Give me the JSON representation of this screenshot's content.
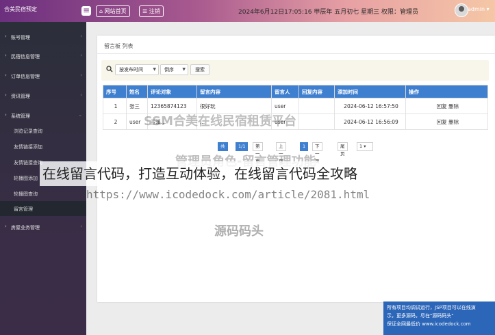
{
  "header": {
    "brand": "合美民宿预定",
    "nav_home": "网站首页",
    "nav_logout": "注销",
    "datetime": "2024年6月12日17:05:16 甲辰年 五月初七 星期三",
    "role_label": "权限：管理员",
    "user": "admin"
  },
  "sidebar": {
    "items": [
      {
        "label": "账号管理"
      },
      {
        "label": "民宿信息管理"
      },
      {
        "label": "订单信息管理"
      },
      {
        "label": "资讯管理"
      },
      {
        "label": "系统管理"
      }
    ],
    "sub_items": [
      {
        "label": "浏览记录查询"
      },
      {
        "label": "友情链接添加"
      },
      {
        "label": "友情链接查询"
      },
      {
        "label": "轮播图添加"
      },
      {
        "label": "轮播图查询"
      },
      {
        "label": "留言管理"
      }
    ],
    "last_item": "房屋业务管理"
  },
  "panel": {
    "title": "留言板 列表",
    "search": {
      "sort_field": "按发布时间",
      "order": "倒序",
      "button": "搜索"
    },
    "table": {
      "headers": [
        "序号",
        "姓名",
        "评论对象",
        "留言内容",
        "留言人",
        "回复内容",
        "添加时间",
        "操作"
      ],
      "rows": [
        {
          "no": "1",
          "name": "张三",
          "target": "12365874123",
          "content": "很好玩",
          "author": "user",
          "reply": "",
          "time": "2024-06-12 16:57:50",
          "ops": "回复 删除"
        },
        {
          "no": "2",
          "name": "user",
          "target": "玉溪...",
          "content": "...",
          "author": "user",
          "reply": "",
          "time": "2024-06-12 16:56:09",
          "ops": "回复 删除"
        }
      ]
    },
    "pager": {
      "total": "共2条",
      "pages": "1/1页",
      "first": "第一页",
      "prev": "上一页",
      "current": "1",
      "next": "下一页",
      "last": "尾页",
      "jump": "1"
    }
  },
  "overlay": {
    "watermark_top": "SSM合美在线民宿租赁平台",
    "watermark_mid": "管理员角色-留言管理功能",
    "banner": "在线留言代码，打造互动体验，在线留言代码全攻略",
    "url": "https://www.icodedock.com/article/2081.html",
    "source": "源码码头",
    "notice_lines": [
      "所有项目均调试运行，JSP项目可以在线演",
      "示，更多源码，尽在\"源码码头\"",
      "保证全网最低价 www.icodedock.com"
    ]
  }
}
